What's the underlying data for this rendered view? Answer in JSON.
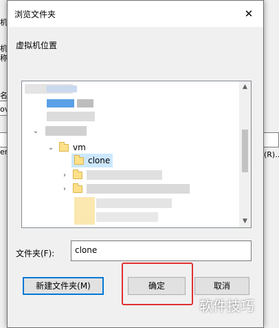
{
  "dialog": {
    "title": "浏览文件夹",
    "close_glyph": "✕",
    "prompt": "虚拟机位置"
  },
  "tree": {
    "items": [
      {
        "label": "vm",
        "expanded": true
      },
      {
        "label": "clone",
        "selected": true
      }
    ]
  },
  "folder_field": {
    "label": "文件夹(F):",
    "value": "clone"
  },
  "buttons": {
    "new_folder": "新建文件夹(M)",
    "ok": "确定",
    "cancel": "取消"
  },
  "background_fragments": {
    "left": [
      "机",
      "机",
      "称",
      "名",
      "ov",
      "er"
    ],
    "right": [
      "(R)..."
    ]
  },
  "watermark": "软件技巧",
  "colors": {
    "selection": "#cce8ff",
    "focus_blue": "#0078d7",
    "highlight_red": "#e03030"
  }
}
